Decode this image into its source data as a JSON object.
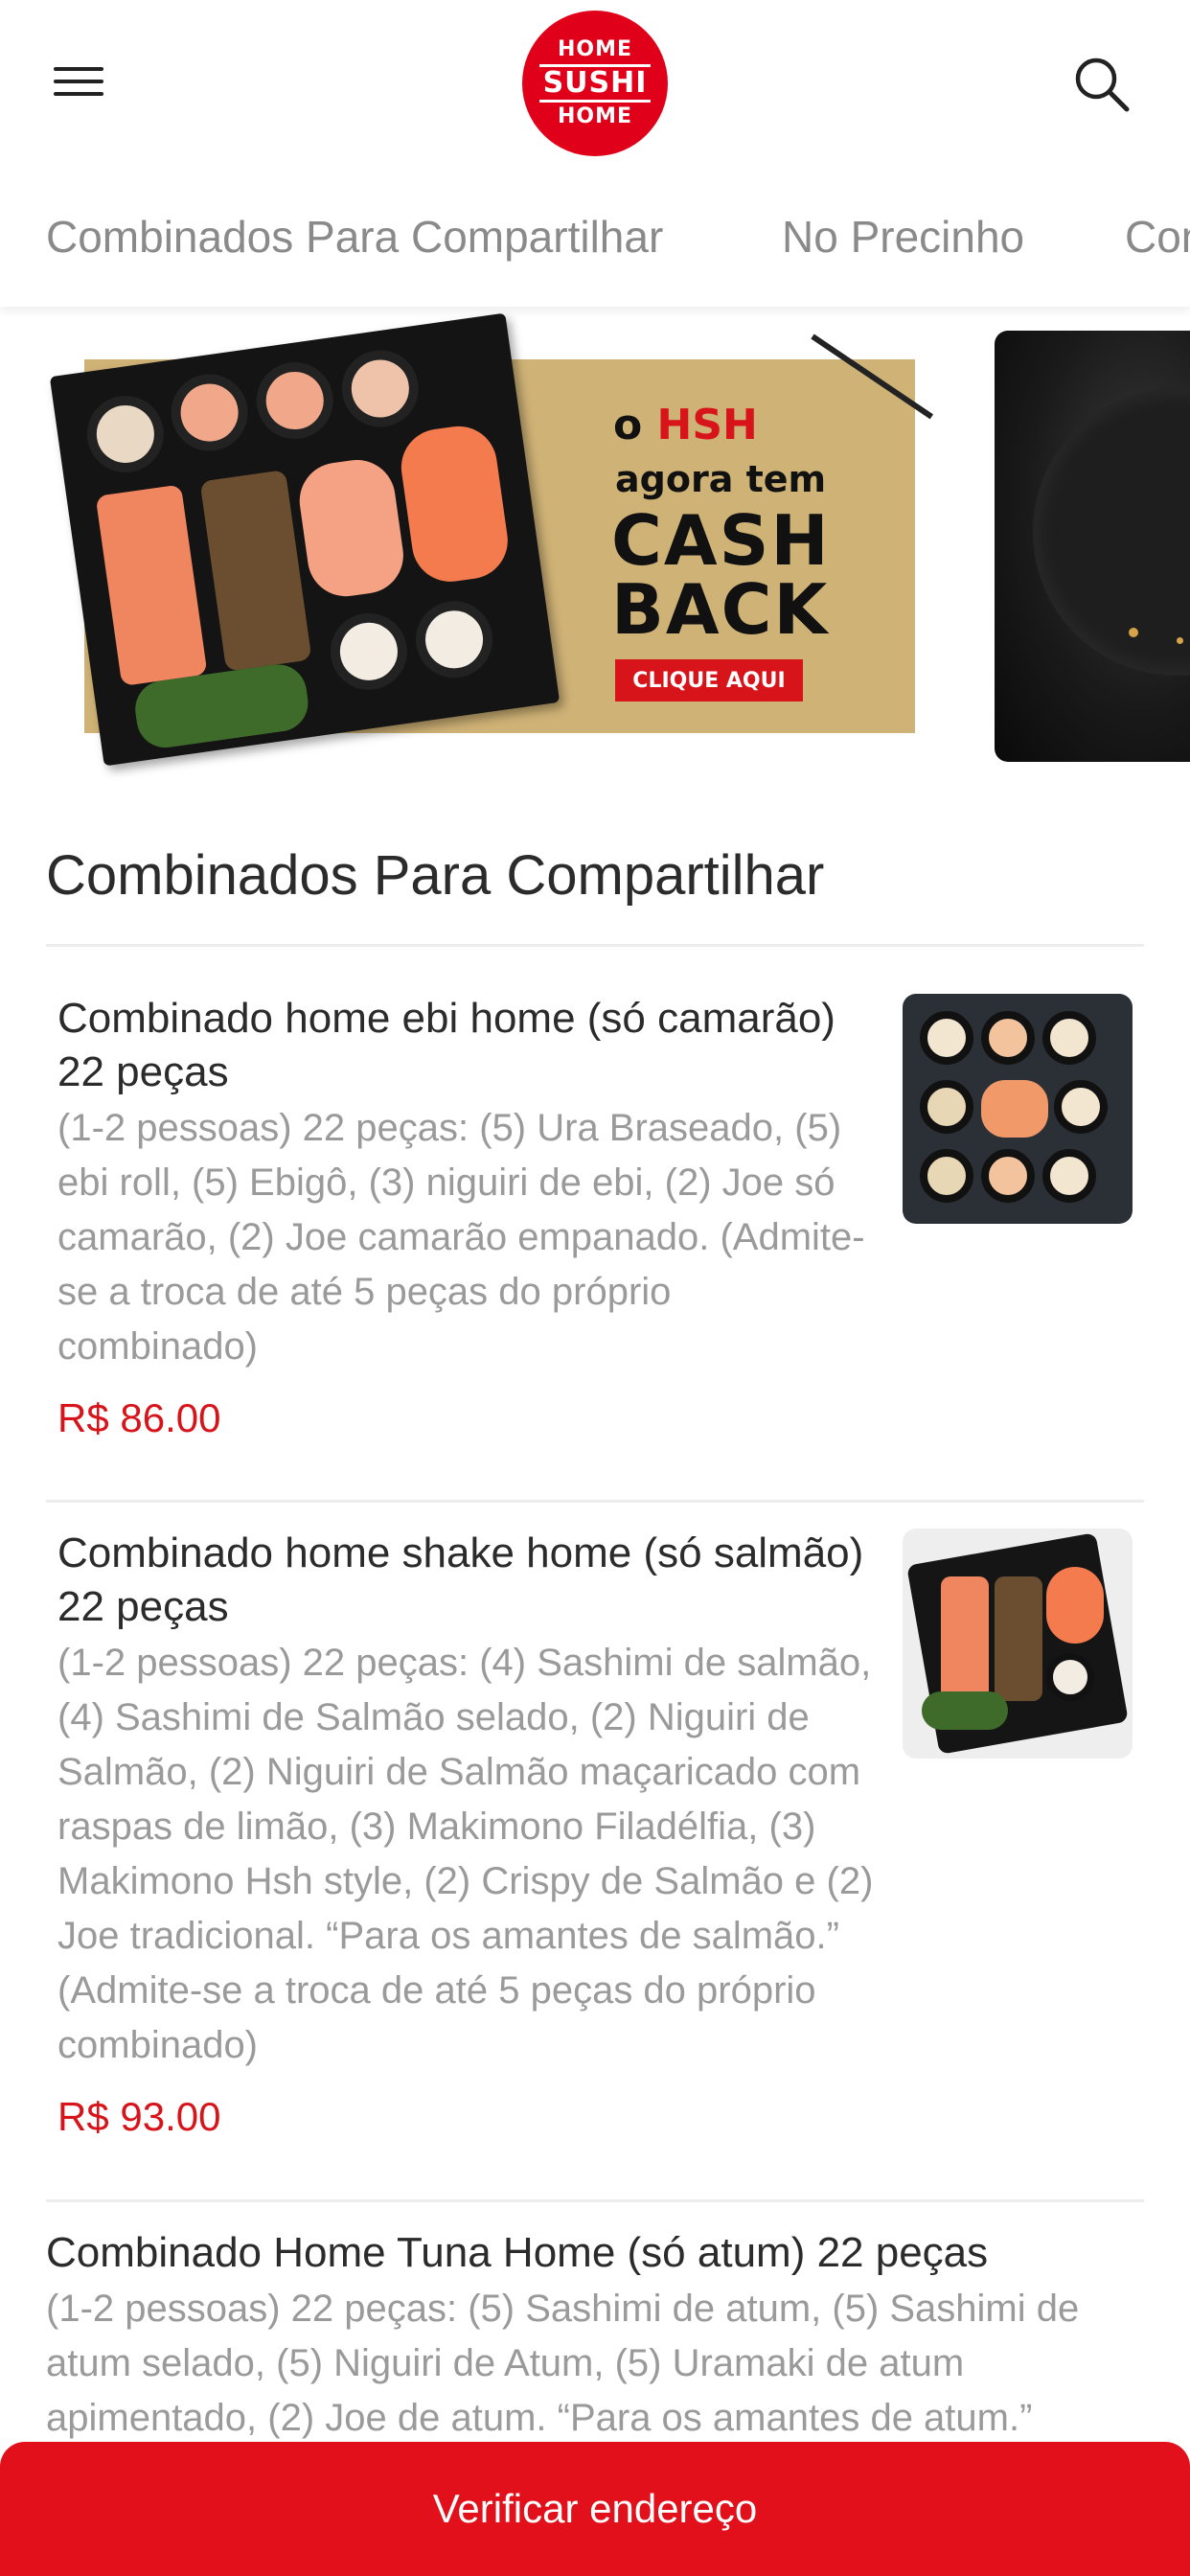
{
  "header": {
    "logo_lines": [
      "HOME",
      "SUSHI",
      "HOME"
    ]
  },
  "tabs": [
    {
      "label": "Combinados Para Compartilhar"
    },
    {
      "label": "No Precinho"
    },
    {
      "label": "Con"
    }
  ],
  "banner": {
    "prefix": "o ",
    "brand": "HSH",
    "tagline": "agora tem",
    "headline_1": "CASH",
    "headline_2": "BACK",
    "cta": "CLIQUE AQUI"
  },
  "section": {
    "title": "Combinados Para Compartilhar",
    "products": [
      {
        "name": "Combinado home ebi home (só camarão) 22 peças",
        "description": "(1-2 pessoas) 22 peças: (5) Ura Braseado, (5) ebi roll, (5) Ebigô, (3) niguiri de ebi, (2) Joe só camarão, (2) Joe camarão empanado. (Admite-se a troca de até 5 peças do próprio combinado)",
        "price": "R$ 86.00"
      },
      {
        "name": "Combinado home shake home (só salmão) 22 peças",
        "description": "(1-2 pessoas) 22 peças: (4) Sashimi de salmão, (4) Sashimi de Salmão selado, (2) Niguiri de Salmão, (2) Niguiri de Salmão maçaricado com raspas de limão, (3) Makimono Filadélfia, (3) Makimono Hsh style, (2) Crispy de Salmão e (2) Joe tradicional. “Para os amantes de salmão.” (Admite-se a troca de até 5 peças do próprio combinado)",
        "price": "R$ 93.00"
      },
      {
        "name": "Combinado Home Tuna Home (só atum) 22 peças",
        "description": "(1-2 pessoas) 22 peças: (5) Sashimi de atum, (5) Sashimi de atum selado, (5) Niguiri de Atum, (5) Uramaki de atum apimentado, (2) Joe de atum. “Para os amantes de atum.”"
      }
    ]
  },
  "bottom_bar": {
    "label": "Verificar endereço"
  },
  "colors": {
    "brand_red": "#e1001a",
    "price_red": "#d8141b",
    "banner_gold": "#cfb276"
  }
}
